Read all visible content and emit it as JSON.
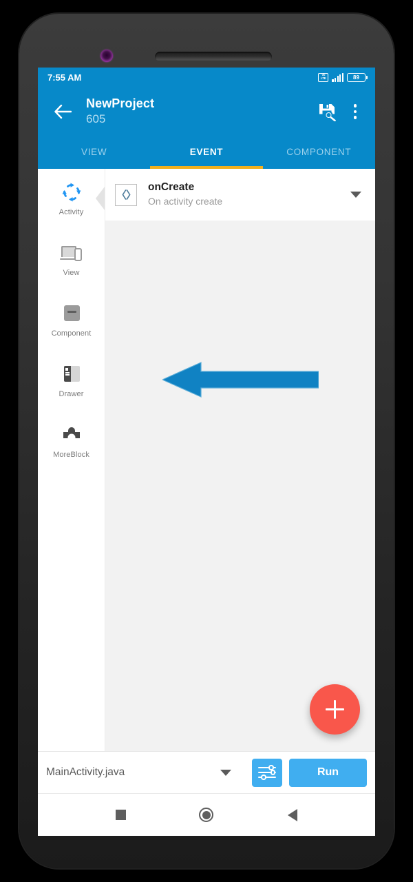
{
  "status_bar": {
    "time": "7:55 AM",
    "network_icon": "volte-icon",
    "volte_top": "Vo",
    "volte_bottom": "LTE",
    "signal_icon": "signal-bars-icon",
    "battery_level": "89"
  },
  "app_bar": {
    "back_icon": "back-arrow-icon",
    "title": "NewProject",
    "subtitle": "605",
    "save_icon": "save-as-icon",
    "overflow_icon": "overflow-menu-icon"
  },
  "tabs": [
    {
      "label": "VIEW",
      "active": false
    },
    {
      "label": "EVENT",
      "active": true
    },
    {
      "label": "COMPONENT",
      "active": false
    }
  ],
  "sidebar": {
    "items": [
      {
        "label": "Activity",
        "icon": "activity-refresh-icon",
        "selected": true
      },
      {
        "label": "View",
        "icon": "view-devices-icon",
        "selected": false
      },
      {
        "label": "Component",
        "icon": "component-box-icon",
        "selected": false
      },
      {
        "label": "Drawer",
        "icon": "drawer-panel-icon",
        "selected": false
      },
      {
        "label": "MoreBlock",
        "icon": "moreblock-puzzle-icon",
        "selected": false
      }
    ]
  },
  "events": [
    {
      "icon": "code-brackets-icon",
      "name": "onCreate",
      "description": "On activity create",
      "expand_icon": "caret-down-icon"
    }
  ],
  "annotation": {
    "arrow_icon": "left-arrow-annotation",
    "points_to": "MoreBlock",
    "color": "#1082C3"
  },
  "fab": {
    "icon": "plus-icon",
    "color": "#F9574B"
  },
  "bottom_bar": {
    "file_name": "MainActivity.java",
    "file_caret_icon": "caret-down-icon",
    "filter_icon": "sliders-settings-icon",
    "run_label": "Run",
    "accent_color": "#40AEF0"
  },
  "nav_bar": {
    "recents_icon": "nav-recents-square-icon",
    "home_icon": "nav-home-circle-icon",
    "back_icon": "nav-back-triangle-icon"
  },
  "theme": {
    "primary": "#0789C9",
    "tab_indicator": "#F2B01E",
    "content_bg": "#F2F2F2"
  },
  "device": {
    "camera_icon": "front-camera-icon",
    "speaker_icon": "earpiece-speaker-icon"
  }
}
